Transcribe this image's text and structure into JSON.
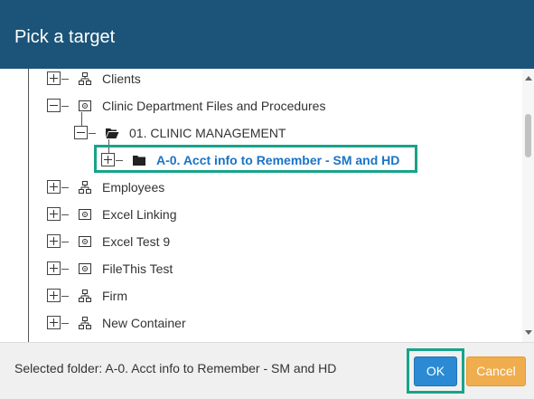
{
  "dialog": {
    "title": "Pick a target"
  },
  "tree": {
    "items": [
      {
        "label": "Clients",
        "icon": "network-icon",
        "expander": "plus"
      },
      {
        "label": "Clinic Department Files and Procedures",
        "icon": "cabinet-icon",
        "expander": "minus"
      },
      {
        "label": "01. CLINIC MANAGEMENT",
        "icon": "folder-open-icon",
        "expander": "minus"
      },
      {
        "label": "A-0. Acct info to Remember - SM and HD",
        "icon": "folder-icon",
        "expander": "plus",
        "selected": true
      },
      {
        "label": "Employees",
        "icon": "network-icon",
        "expander": "plus"
      },
      {
        "label": "Excel Linking",
        "icon": "cabinet-icon",
        "expander": "plus"
      },
      {
        "label": "Excel Test 9",
        "icon": "cabinet-icon",
        "expander": "plus"
      },
      {
        "label": "FileThis Test",
        "icon": "cabinet-icon",
        "expander": "plus"
      },
      {
        "label": "Firm",
        "icon": "network-icon",
        "expander": "plus"
      },
      {
        "label": "New Container",
        "icon": "network-icon",
        "expander": "plus"
      }
    ]
  },
  "footer": {
    "selected_text": "Selected folder: A-0. Acct info to Remember - SM and HD",
    "ok_label": "OK",
    "cancel_label": "Cancel"
  },
  "colors": {
    "header": "#1b5478",
    "highlight": "#18a38a",
    "ok": "#2b8ad3",
    "cancel": "#f0ad4e",
    "selected_text": "#1a73c7"
  }
}
